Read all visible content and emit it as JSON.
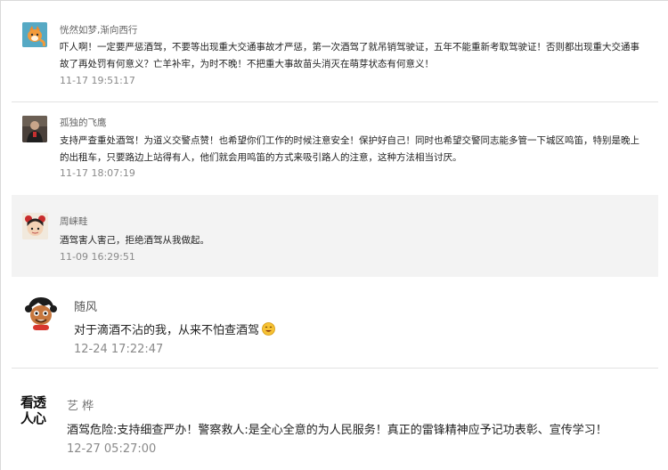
{
  "comments": [
    {
      "user": "恍然如梦,渐向西行",
      "text": "吓人啊！一定要严惩酒驾，不要等出现重大交通事故才严惩，第一次酒驾了就吊销驾驶证，五年不能重新考取驾驶证！否则都出现重大交通事故了再处罚有何意义？亡羊补牢，为时不晚！不把重大事故苗头消灭在萌芽状态有何意义！",
      "time": "11-17 19:51:17",
      "avatar": "fox-avatar-icon"
    },
    {
      "user": "孤独的飞鹰",
      "text": "支持严查重处酒驾！为道义交警点赞！也希望你们工作的时候注意安全！保护好自己！同时也希望交警同志能多管一下城区鸣笛，特别是晚上的出租车，只要路边上站得有人，他们就会用鸣笛的方式来吸引路人的注意，这种方法相当讨厌。",
      "time": "11-17 18:07:19",
      "avatar": "person-photo-avatar-icon"
    },
    {
      "user": "周崃畦",
      "text": "酒驾害人害己，拒绝酒驾从我做起。",
      "time": "11-09 16:29:51",
      "avatar": "cartoon-girl-avatar-icon"
    },
    {
      "user": "随风",
      "text": "对于滴酒不沾的我，从来不怕查酒驾",
      "time": "12-24 17:22:47",
      "avatar": "cartoon-boy-avatar-icon",
      "emoji": "smile-emoji-icon"
    },
    {
      "user": "艺 桦",
      "text": "酒驾危险:支持细查严办！警察救人:是全心全意的为人民服务！真正的雷锋精神应予记功表彰、宣传学习！",
      "time": "12-27 05:27:00",
      "avatar": "calligraphy-logo-avatar-icon",
      "avatar_text": "看透人心"
    }
  ],
  "colors": {
    "highlight_row": "#f3f3f3",
    "time": "#8a8a8a",
    "name": "#666666"
  }
}
